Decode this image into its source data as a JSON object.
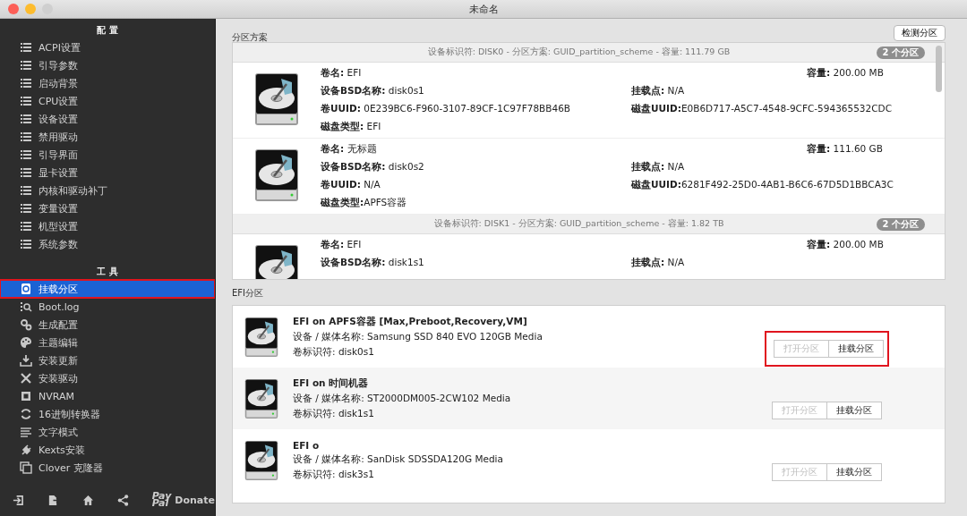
{
  "window": {
    "title": "未命名"
  },
  "sidebar": {
    "sections": [
      {
        "title": "配 置",
        "items": [
          {
            "label": "ACPI设置",
            "selected": false,
            "highlighted": false
          },
          {
            "label": "引导参数",
            "selected": false,
            "highlighted": false
          },
          {
            "label": "启动背景",
            "selected": false,
            "highlighted": false
          },
          {
            "label": "CPU设置",
            "selected": false,
            "highlighted": false
          },
          {
            "label": "设备设置",
            "selected": false,
            "highlighted": false
          },
          {
            "label": "禁用驱动",
            "selected": false,
            "highlighted": false
          },
          {
            "label": "引导界面",
            "selected": false,
            "highlighted": false
          },
          {
            "label": "显卡设置",
            "selected": false,
            "highlighted": false
          },
          {
            "label": "内核和驱动补丁",
            "selected": false,
            "highlighted": false
          },
          {
            "label": "变量设置",
            "selected": false,
            "highlighted": false
          },
          {
            "label": "机型设置",
            "selected": false,
            "highlighted": false
          },
          {
            "label": "系统参数",
            "selected": false,
            "highlighted": false
          }
        ]
      },
      {
        "title": "工 具",
        "items": [
          {
            "label": "挂载分区",
            "selected": true,
            "highlighted": true
          },
          {
            "label": "Boot.log",
            "selected": false,
            "highlighted": false
          },
          {
            "label": "生成配置",
            "selected": false,
            "highlighted": false
          },
          {
            "label": "主题编辑",
            "selected": false,
            "highlighted": false
          },
          {
            "label": "安装更新",
            "selected": false,
            "highlighted": false
          },
          {
            "label": "安装驱动",
            "selected": false,
            "highlighted": false
          },
          {
            "label": "NVRAM",
            "selected": false,
            "highlighted": false
          },
          {
            "label": "16进制转换器",
            "selected": false,
            "highlighted": false
          },
          {
            "label": "文字模式",
            "selected": false,
            "highlighted": false
          },
          {
            "label": "Kexts安装",
            "selected": false,
            "highlighted": false
          },
          {
            "label": "Clover 克隆器",
            "selected": false,
            "highlighted": false
          }
        ]
      }
    ],
    "footer": {
      "paypal_logo": [
        "Pay",
        "Pal"
      ],
      "donate": "Donate"
    }
  },
  "partition_scheme": {
    "title": "分区方案",
    "detect_button": "检测分区",
    "disks": [
      {
        "header": "设备标识符: DISK0 - 分区方案: GUID_partition_scheme - 容量: 111.79 GB",
        "badge": "2 个分区",
        "partitions": [
          {
            "name": "**卷名:** EFI",
            "capacity": "**容量:**  200.00 MB",
            "bsd": "**设备BSD名称:** disk0s1",
            "mount": "**挂载点:** N/A",
            "volume_uuid": "**卷UUID:** 0E239BC6-F960-3107-89CF-1C97F78BB46B",
            "disk_uuid": "**磁盘UUID:**E0B6D717-A5C7-4548-9CFC-594365532CDC",
            "type": "**磁盘类型:** EFI"
          },
          {
            "name": "**卷名:** 无标题",
            "capacity": "**容量:**  111.60 GB",
            "bsd": "**设备BSD名称:** disk0s2",
            "mount": "**挂载点:** N/A",
            "volume_uuid": "**卷UUID:** N/A",
            "disk_uuid": "**磁盘UUID:**6281F492-25D0-4AB1-B6C6-67D5D1BBCA3C",
            "type": "**磁盘类型:**APFS容器"
          }
        ]
      },
      {
        "header": "设备标识符: DISK1 - 分区方案: GUID_partition_scheme - 容量: 1.82 TB",
        "badge": "2 个分区",
        "partitions": [
          {
            "name": "**卷名:** EFI",
            "capacity": "**容量:**  200.00 MB",
            "bsd": "**设备BSD名称:** disk1s1",
            "mount": "**挂载点:** N/A"
          }
        ]
      }
    ]
  },
  "efi_partitions": {
    "title": "EFI分区",
    "rows": [
      {
        "title": "EFI on APFS容器 [Max,Preboot,Recovery,VM]",
        "media": "设备 / 媒体名称: Samsung SSD 840 EVO 120GB Media",
        "identifier": "卷标识符: disk0s1",
        "highlighted": true,
        "buttons": [
          {
            "label": "打开分区",
            "disabled": true
          },
          {
            "label": "挂载分区",
            "disabled": false
          }
        ]
      },
      {
        "title": "EFI on 时间机器",
        "media": "设备 / 媒体名称: ST2000DM005-2CW102 Media",
        "identifier": "卷标识符: disk1s1",
        "highlighted": false,
        "buttons": [
          {
            "label": "打开分区",
            "disabled": true
          },
          {
            "label": "挂载分区",
            "disabled": false
          }
        ]
      },
      {
        "title": "EFI o",
        "media": "设备 / 媒体名称: SanDisk SDSSDA120G Media",
        "identifier": "卷标识符: disk3s1",
        "highlighted": false,
        "buttons": [
          {
            "label": "打开分区",
            "disabled": true
          },
          {
            "label": "挂载分区",
            "disabled": false
          }
        ]
      }
    ]
  }
}
